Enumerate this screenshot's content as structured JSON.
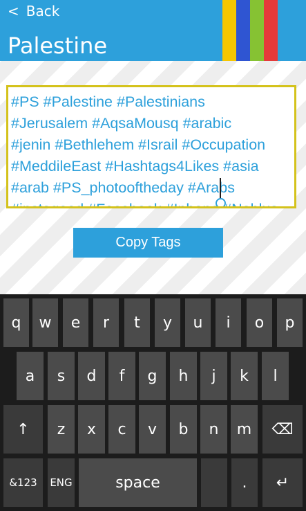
{
  "header": {
    "back_label": "Back",
    "back_icon": "chevron-left-icon",
    "title": "Palestine",
    "stripe_colors": [
      "#f5c600",
      "#2f55d2",
      "#86c233",
      "#e53a3a"
    ],
    "background": "#2da0db"
  },
  "tags": {
    "lines": [
      "#PS #Palestine #Palestinians",
      "#Jerusalem #AqsaMousq #arabic",
      "#jenin #Bethlehem #Israil #Occupation",
      "#MeddileEast #Hashtags4Likes #asia",
      "#arab #PS_photooftheday #Arabs",
      "#instagood #Facebook #Iphone #Nablus"
    ],
    "text_color": "#2da0db",
    "border_color": "#d4c21b"
  },
  "copy_button": {
    "label": "Copy Tags"
  },
  "keyboard": {
    "row1": [
      "q",
      "w",
      "e",
      "r",
      "t",
      "y",
      "u",
      "i",
      "o",
      "p"
    ],
    "row2": [
      "a",
      "s",
      "d",
      "f",
      "g",
      "h",
      "j",
      "k",
      "l"
    ],
    "row3": [
      "z",
      "x",
      "c",
      "v",
      "b",
      "n",
      "m"
    ],
    "shift": "↑",
    "backspace": "⌫",
    "symbols": "&123",
    "language": "ENG",
    "space": "space",
    "period": ".",
    "enter": "↵"
  }
}
